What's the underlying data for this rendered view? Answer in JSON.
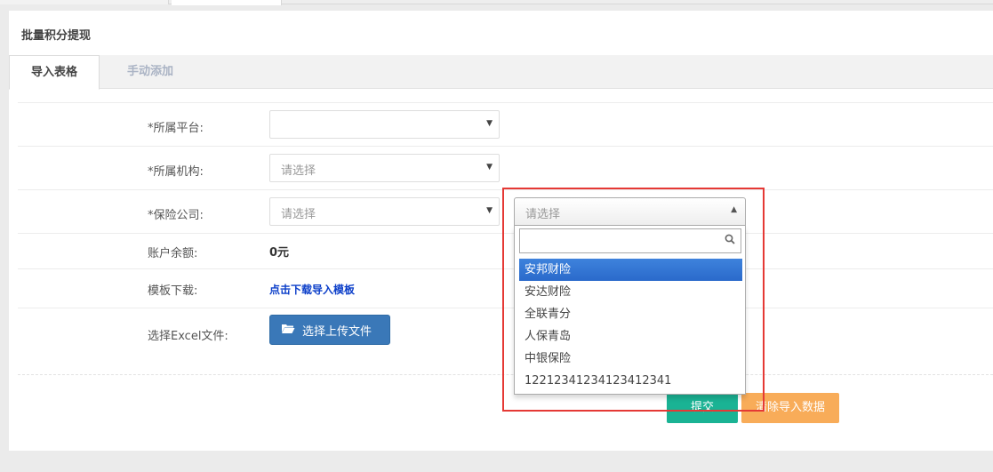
{
  "panel": {
    "title": "批量积分提现"
  },
  "tabs": [
    {
      "label": "导入表格",
      "active": true
    },
    {
      "label": "手动添加",
      "active": false
    }
  ],
  "form": {
    "platform": {
      "label": "*所属平台:",
      "value": ""
    },
    "org": {
      "label": "*所属机构:",
      "placeholder": "请选择"
    },
    "company": {
      "label": "*保险公司:",
      "placeholder": "请选择"
    },
    "balance": {
      "label": "账户余额:",
      "value": "0元"
    },
    "template": {
      "label": "模板下载:",
      "link": "点击下载导入模板"
    },
    "excel": {
      "label": "选择Excel文件:",
      "button": "选择上传文件"
    }
  },
  "buttons": {
    "submit": "提交",
    "clear": "清除导入数据"
  },
  "dropdown": {
    "placeholder": "请选择",
    "search_value": "",
    "options": [
      "安邦财险",
      "安达财险",
      "全联青分",
      "人保青岛",
      "中银保险",
      "12212341234123412341"
    ],
    "highlighted_index": 0
  },
  "colors": {
    "submit": "#1ab394",
    "clear": "#f8ac59",
    "upload": "#3a78b8",
    "highlight": "#3875d7",
    "annotation": "#e53935"
  }
}
